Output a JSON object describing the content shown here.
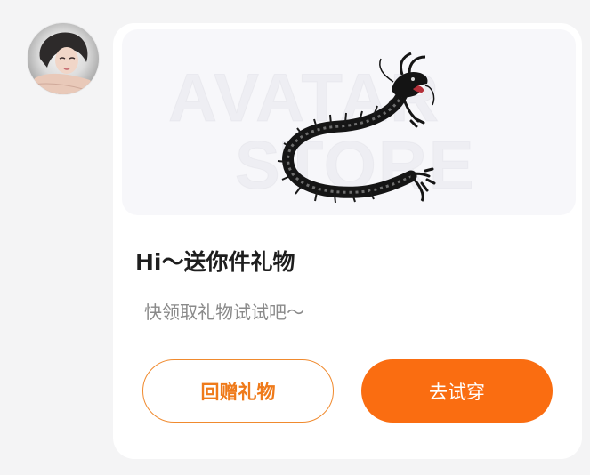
{
  "colors": {
    "page_background": "#f4f4f5",
    "card_background": "#ffffff",
    "accent": "#fa6d11",
    "outline_button_border": "#f08a2e",
    "outline_button_text": "#ef7a1a",
    "title_text": "#1e1e1e",
    "subtitle_text": "#8a8a8a"
  },
  "sender": {
    "avatar_icon": "user-avatar-photo"
  },
  "gift_card": {
    "banner": {
      "watermark_line1": "AVATAR",
      "watermark_line2": "STORE",
      "image_icon": "dragon-icon"
    },
    "title": "Hi～送你件礼物",
    "subtitle": "快领取礼物试试吧～",
    "actions": {
      "return_gift_label": "回赠礼物",
      "try_on_label": "去试穿"
    }
  }
}
